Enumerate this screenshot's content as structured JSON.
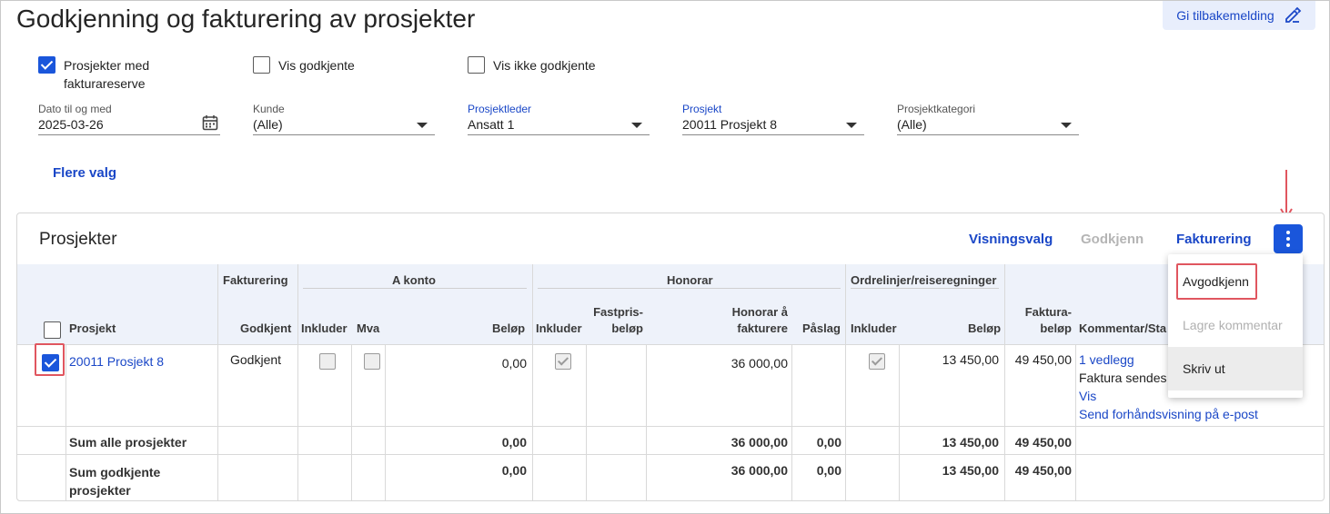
{
  "page": {
    "title": "Godkjenning og fakturering av prosjekter"
  },
  "feedback": {
    "label": "Gi tilbakemelding"
  },
  "filters": {
    "with_reserve": {
      "label_line1": "Prosjekter med",
      "label_line2": "fakturareserve",
      "checked": true
    },
    "show_approved": {
      "label": "Vis godkjente",
      "checked": false
    },
    "show_unapproved": {
      "label": "Vis ikke godkjente",
      "checked": false
    },
    "date": {
      "label": "Dato til og med",
      "value": "2025-03-26"
    },
    "customer": {
      "label": "Kunde",
      "value": "(Alle)"
    },
    "project_manager": {
      "label": "Prosjektleder",
      "value": "Ansatt 1"
    },
    "project": {
      "label": "Prosjekt",
      "value": "20011 Prosjekt 8"
    },
    "project_category": {
      "label": "Prosjektkategori",
      "value": "(Alle)"
    },
    "more_options": "Flere valg"
  },
  "panel": {
    "title": "Prosjekter",
    "view_options": "Visningsvalg",
    "approve": "Godkjenn",
    "invoicing": "Fakturering"
  },
  "table": {
    "groups": {
      "fakturering": "Fakturering",
      "a_konto": "A konto",
      "honorar": "Honorar",
      "ordrelinjer": "Ordrelinjer/reiseregninger"
    },
    "columns": {
      "prosjekt": "Prosjekt",
      "godkjent": "Godkjent",
      "a_inkluder": "Inkluder",
      "a_mva": "Mva",
      "a_belop": "Beløp",
      "h_inkluder": "Inkluder",
      "h_fastpris_1": "Fastpris-",
      "h_fastpris_2": "beløp",
      "h_honorar_1": "Honorar å",
      "h_honorar_2": "fakturere",
      "h_paslag": "Påslag",
      "o_inkluder": "Inkluder",
      "o_belop": "Beløp",
      "faktura_1": "Faktura-",
      "faktura_2": "beløp",
      "kommentar": "Kommentar/Sta"
    },
    "row": {
      "project": "20011 Prosjekt 8",
      "status": "Godkjent",
      "a_belop": "0,00",
      "h_honorar": "36 000,00",
      "o_belop": "13 450,00",
      "faktura": "49 450,00",
      "attachment": "1 vedlegg",
      "comment": "Faktura sendes",
      "view": "Vis",
      "send_preview": "Send forhåndsvisning på e-post"
    },
    "sum_all": {
      "label": "Sum alle prosjekter",
      "a_belop": "0,00",
      "h_honorar": "36 000,00",
      "h_paslag": "0,00",
      "o_belop": "13 450,00",
      "faktura": "49 450,00"
    },
    "sum_approved": {
      "label_line1": "Sum godkjente",
      "label_line2": "prosjekter",
      "a_belop": "0,00",
      "h_honorar": "36 000,00",
      "h_paslag": "0,00",
      "o_belop": "13 450,00",
      "faktura": "49 450,00"
    }
  },
  "menu": {
    "unapprove": "Avgodkjenn",
    "save_comment": "Lagre kommentar",
    "print": "Skriv ut"
  },
  "colors": {
    "accent": "#1a56db",
    "link": "#1a47c7",
    "annotation": "#e0565f"
  }
}
